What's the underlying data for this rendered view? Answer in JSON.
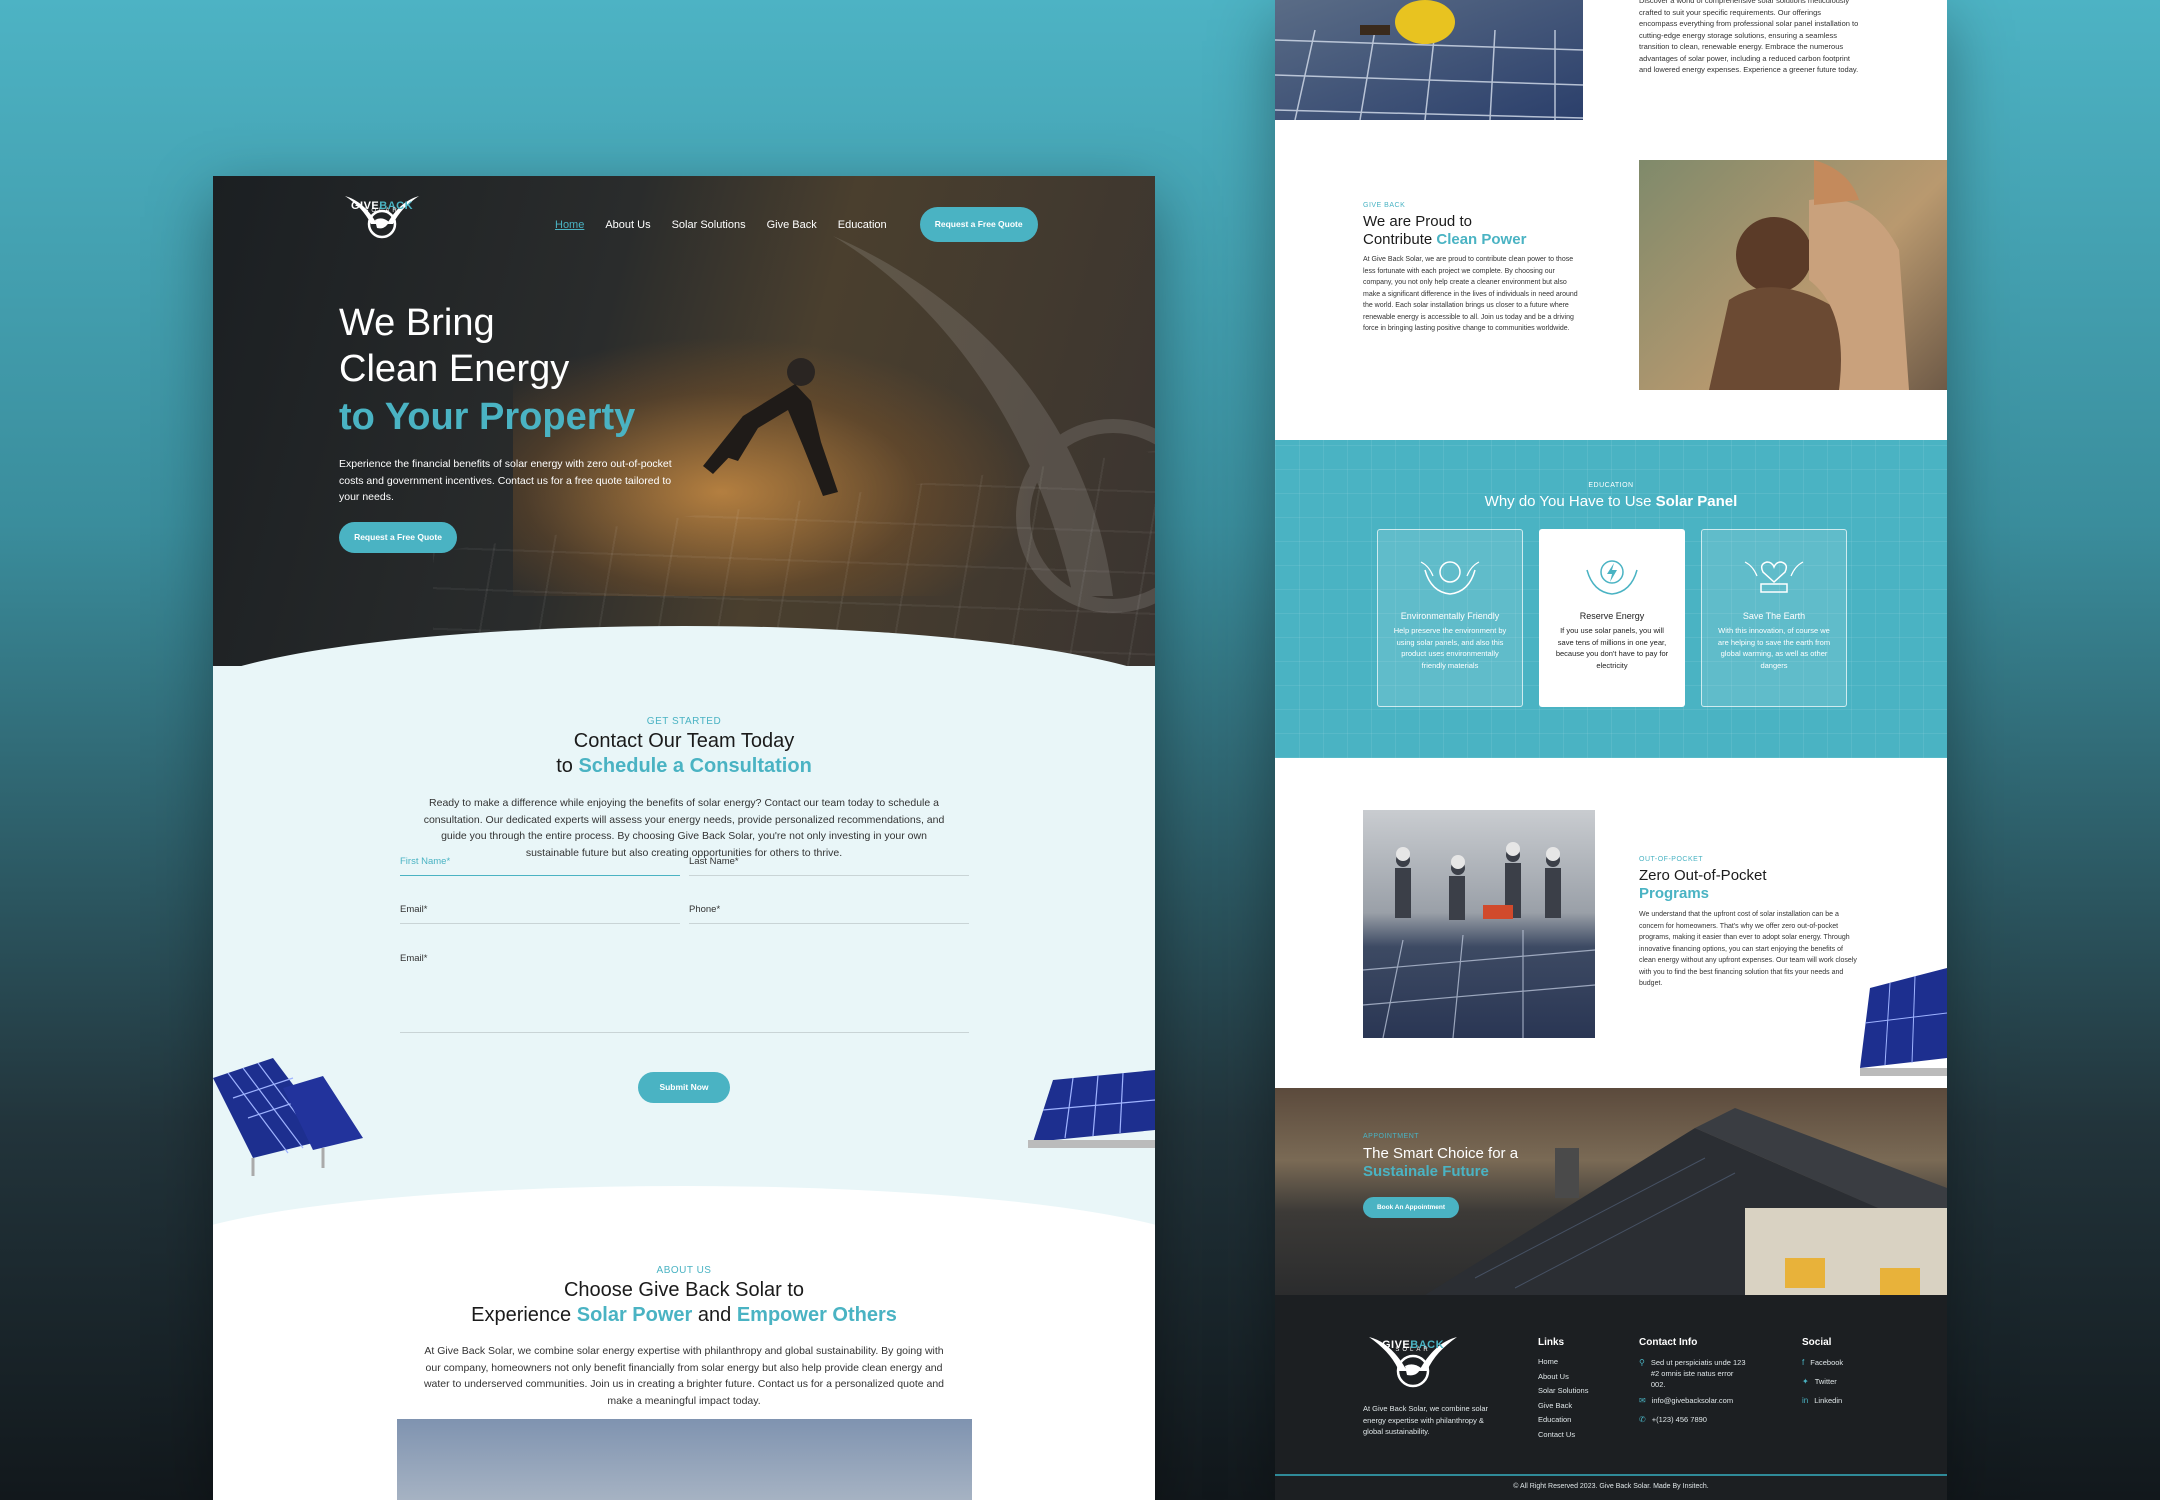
{
  "nav": {
    "logo_top": "GIVE",
    "logo_accent": "BACK",
    "logo_sub": "SOLAR",
    "items": [
      "Home",
      "About Us",
      "Solar Solutions",
      "Give Back",
      "Education"
    ],
    "cta": "Request a Free Quote"
  },
  "hero": {
    "line1": "We Bring",
    "line2": "Clean Energy",
    "line3": "to Your Property",
    "sub": "Experience the financial benefits of solar energy with zero out-of-pocket costs and government incentives. Contact us for a free quote tailored to your needs.",
    "cta": "Request a Free Quote"
  },
  "contact": {
    "eyebrow": "GET STARTED",
    "title1": "Contact Our Team Today",
    "title2_pre": "to ",
    "title2_accent": "Schedule a Consultation",
    "para": "Ready to make a difference while enjoying the benefits of solar energy? Contact our team today to schedule a consultation. Our dedicated experts will assess your energy needs, provide personalized recommendations, and guide you through the entire process. By choosing Give Back Solar, you're not only investing in your own sustainable future but also creating opportunities for others to thrive.",
    "first_name": "First Name*",
    "last_name": "Last Name*",
    "email": "Email*",
    "phone": "Phone*",
    "message": "Email*",
    "submit": "Submit Now"
  },
  "about": {
    "eyebrow": "ABOUT US",
    "title1": "Choose Give Back Solar to",
    "title2_pre": "Experience ",
    "title2_a": "Solar Power",
    "title2_mid": " and ",
    "title2_b": "Empower Others",
    "para": "At Give Back Solar, we combine solar energy expertise with philanthropy and global sustainability. By going with our company, homeowners not only benefit financially from solar energy but also help provide clean energy and water to underserved communities. Join us in creating a brighter future. Contact us for a personalized quote and make a meaningful impact today."
  },
  "solutions_text": "Discover a world of comprehensive solar solutions meticulously crafted to suit your specific requirements. Our offerings encompass everything from professional solar panel installation to cutting-edge energy storage solutions, ensuring a seamless transition to clean, renewable energy. Embrace the numerous advantages of solar power, including a reduced carbon footprint and lowered energy expenses. Experience a greener future today.",
  "giveback": {
    "eyebrow": "GIVE BACK",
    "title1": "We are Proud to",
    "title2_pre": "Contribute ",
    "title2_accent": "Clean Power",
    "para": "At Give Back Solar, we are proud to contribute clean power to those less fortunate with each project we complete. By choosing our company, you not only help create a cleaner environment but also make a significant difference in the lives of individuals in need around the world. Each solar installation brings us closer to a future where renewable energy is accessible to all. Join us today and be a driving force in bringing lasting positive change to communities worldwide."
  },
  "education": {
    "eyebrow": "EDUCATION",
    "title_pre": "Why do You Have to Use ",
    "title_accent": "Solar Panel",
    "cards": [
      {
        "title": "Environmentally Friendly",
        "desc": "Help preserve the environment by using solar panels, and also this product uses environmentally friendly materials",
        "icon": "earth-hands-icon"
      },
      {
        "title": "Reserve Energy",
        "desc": "If you use solar panels, you will save tens of millions in one year, because you don't have to pay for electricity",
        "icon": "bolt-hands-icon"
      },
      {
        "title": "Save The Earth",
        "desc": "With this innovation, of course we are helping to save the earth from global warming, as well as other dangers",
        "icon": "heart-earth-icon"
      }
    ]
  },
  "outofpocket": {
    "eyebrow": "OUT-OF-POCKET",
    "title1": "Zero Out-of-Pocket",
    "title2": "Programs",
    "para": "We understand that the upfront cost of solar installation can be a concern for homeowners. That's why we offer zero out-of-pocket programs, making it easier than ever to adopt solar energy. Through innovative financing options, you can start enjoying the benefits of clean energy without any upfront expenses. Our team will work closely with you to find the best financing solution that fits your needs and budget."
  },
  "appointment": {
    "eyebrow": "APPOINTMENT",
    "title1": "The Smart Choice for a",
    "title2": "Sustainale Future",
    "cta": "Book An Appointment"
  },
  "footer": {
    "about": "At Give Back Solar, we combine solar energy expertise with philanthropy & global sustainability.",
    "links_title": "Links",
    "links": [
      "Home",
      "About Us",
      "Solar Solutions",
      "Give Back",
      "Education",
      "Contact Us"
    ],
    "contact_title": "Contact Info",
    "address": "Sed ut perspiciatis unde 123 #2 omnis iste natus error 002.",
    "email": "info@givebacksolar.com",
    "phone": "+(123) 456 7890",
    "social_title": "Social",
    "social": [
      "Facebook",
      "Twitter",
      "Linkedin"
    ],
    "copyright": "© All Right Reserved 2023. Give Back Solar. Made By Insitech."
  },
  "colors": {
    "accent": "#4ab3c3",
    "dark": "#1c1f22",
    "light_bg": "#e9f6f8"
  }
}
